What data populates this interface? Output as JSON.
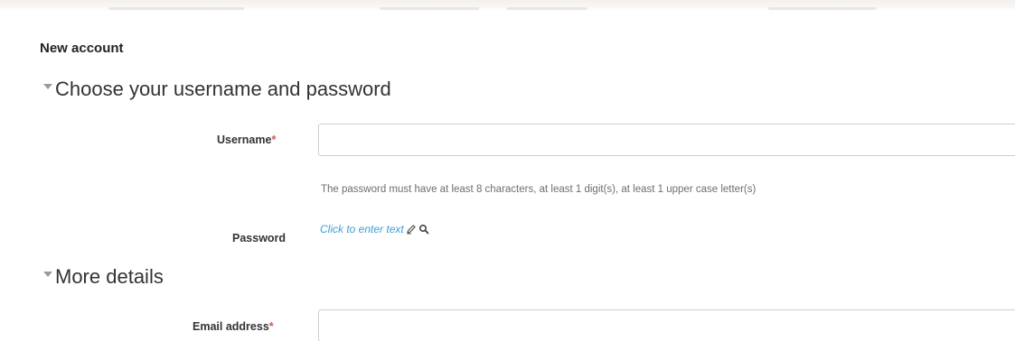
{
  "page": {
    "title": "New account"
  },
  "sections": [
    {
      "label": "Choose your username and password"
    },
    {
      "label": "More details"
    }
  ],
  "fields": {
    "username": {
      "label": "Username",
      "required_mark": "*",
      "value": ""
    },
    "password": {
      "label": "Password",
      "help_text": "The password must have at least 8 characters, at least 1 digit(s), at least 1 upper case letter(s)",
      "link_text": "Click to enter text",
      "icons": [
        "pencil-icon",
        "search-icon"
      ]
    },
    "email": {
      "label": "Email address",
      "required_mark": "*",
      "value": ""
    }
  },
  "colors": {
    "highlight": "#f6f60e",
    "required": "#d9534f",
    "link": "#3aa0d4",
    "caret": "#9a9a9a",
    "input_border": "#cfcfcf"
  }
}
